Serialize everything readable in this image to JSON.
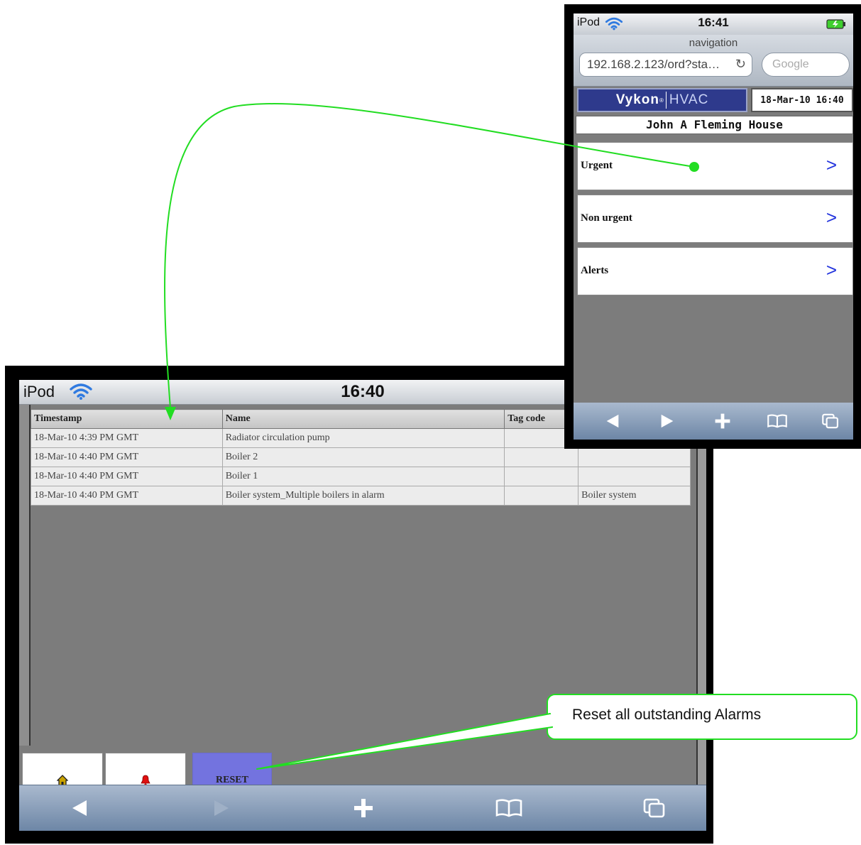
{
  "big_screen": {
    "status": {
      "carrier": "iPod",
      "time": "16:40"
    },
    "table": {
      "headers": [
        "Timestamp",
        "Name",
        "Tag code",
        ""
      ],
      "rows": [
        [
          "18-Mar-10 4:39 PM GMT",
          "Radiator circulation pump",
          "",
          ""
        ],
        [
          "18-Mar-10 4:40 PM GMT",
          "Boiler 2",
          "",
          ""
        ],
        [
          "18-Mar-10 4:40 PM GMT",
          "Boiler 1",
          "",
          ""
        ],
        [
          "18-Mar-10 4:40 PM GMT",
          "Boiler system_Multiple boilers in alarm",
          "",
          "Boiler system"
        ]
      ]
    },
    "buttons": {
      "reset_label": "RESET",
      "home_icon": "home-icon",
      "bell_icon": "alarm-bell-icon"
    },
    "toolbar": [
      "back-icon",
      "forward-icon",
      "add-icon",
      "bookmarks-icon",
      "pages-icon"
    ]
  },
  "small_screen": {
    "status": {
      "carrier": "iPod",
      "time": "16:41"
    },
    "nav_title": "navigation",
    "url": "192.168.2.123/ord?sta…",
    "search_placeholder": "Google",
    "brand": {
      "name": "Vykon",
      "mark": "®",
      "product": "HVAC"
    },
    "date": "18-Mar-10 16:40",
    "site_name": "John A Fleming House",
    "menu": [
      {
        "label": "Urgent",
        "chevron": ">"
      },
      {
        "label": "Non urgent",
        "chevron": ">"
      },
      {
        "label": "Alerts",
        "chevron": ">"
      }
    ]
  },
  "callout": {
    "text": "Reset all outstanding Alarms"
  },
  "colors": {
    "annotation": "#22dd22",
    "reset_button": "#7373df",
    "brand_bar": "#2e3a8c",
    "chevron": "#2233dd"
  }
}
